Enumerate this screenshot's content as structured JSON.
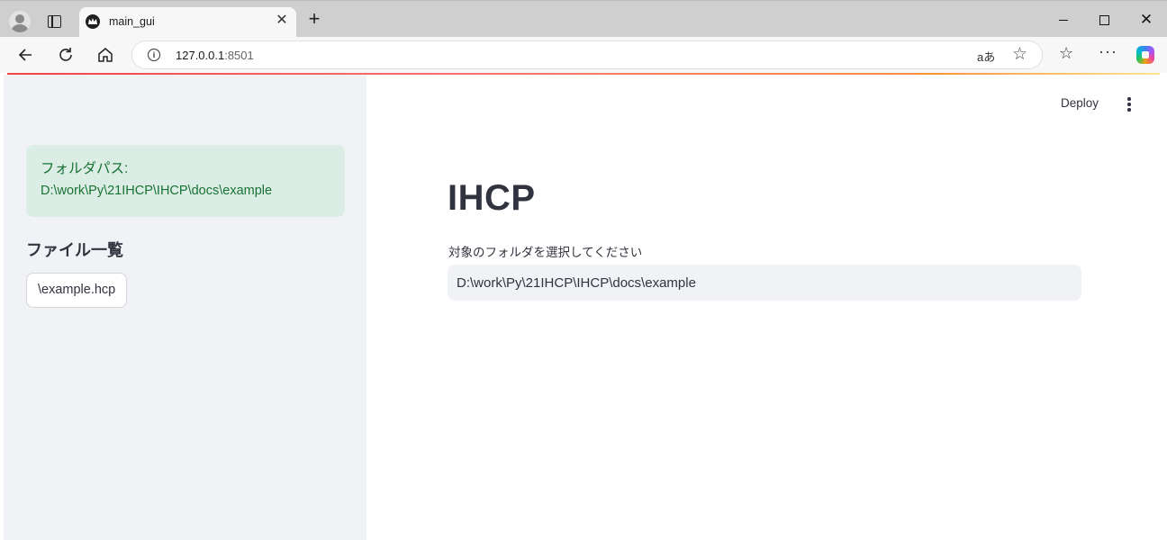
{
  "browser": {
    "tab_title": "main_gui",
    "tab_close": "✕",
    "new_tab": "+",
    "url_host": "127.0.0.1",
    "url_port": ":8501",
    "read_aloud_label": "aあ",
    "window_close": "✕"
  },
  "header": {
    "deploy_label": "Deploy"
  },
  "sidebar": {
    "folder_label": "フォルダパス:",
    "folder_path": "D:\\work\\Py\\21IHCP\\IHCP\\docs\\example",
    "file_list_title": "ファイル一覧",
    "files": [
      "\\example.hcp"
    ]
  },
  "main": {
    "title": "IHCP",
    "input_label": "対象のフォルダを選択してください",
    "input_value": "D:\\work\\Py\\21IHCP\\IHCP\\docs\\example"
  },
  "colors": {
    "success_bg": "#dcede5",
    "success_text": "#177233",
    "sidebar_bg": "#f0f2f6",
    "text": "#31333f"
  }
}
